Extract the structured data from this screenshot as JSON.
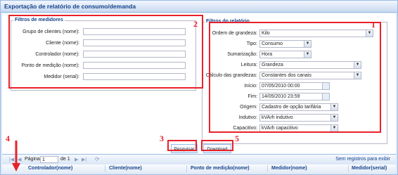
{
  "window": {
    "title": "Exportação de relatório de consumo/demanda"
  },
  "filters_meters": {
    "legend": "Filtros de medidores",
    "fields": [
      {
        "label": "Grupo de clientes (nome):",
        "value": ""
      },
      {
        "label": "Cliente (nome):",
        "value": ""
      },
      {
        "label": "Controlador (nome):",
        "value": ""
      },
      {
        "label": "Ponto de medição (nome):",
        "value": ""
      },
      {
        "label": "Medidor (serial):",
        "value": ""
      }
    ]
  },
  "filters_report": {
    "legend": "Filtros do relatório",
    "ordem": {
      "label": "Ordem de grandeza:",
      "value": "Kilo"
    },
    "tipo": {
      "label": "Tipo:",
      "value": "Consumo"
    },
    "sumarizacao": {
      "label": "Sumarização:",
      "value": "Hora"
    },
    "leitura": {
      "label": "Leitura:",
      "value": "Grandeza"
    },
    "calculo": {
      "label": "Cálculo das grandezas:",
      "value": "Constantes dos canais"
    },
    "inicio": {
      "label": "Início:",
      "value": "07/05/2010 00:00"
    },
    "fim": {
      "label": "Fim:",
      "value": "14/05/2010 23:59"
    },
    "origem": {
      "label": "Origem:",
      "value": "Cadastro de opção tarifária"
    },
    "indutivo": {
      "label": "Indutivo:",
      "value": "kVArh indutivo"
    },
    "capacitivo": {
      "label": "Capacitivo:",
      "value": "kVArh capacitivo"
    }
  },
  "buttons": {
    "pesquisar": "Pesquisar",
    "download": "Download"
  },
  "pager": {
    "page_label": "Página",
    "page_value": "1",
    "of_label": "de 1",
    "empty_msg": "Sem registros para exibir"
  },
  "grid": {
    "columns": [
      "Controlador(nome)",
      "Cliente(nome)",
      "Ponto de medição(nome)",
      "Medidor(nome)",
      "Medidor(serial)"
    ]
  },
  "annotations": [
    "1",
    "2",
    "3",
    "4",
    "5"
  ],
  "colors": {
    "annotation": "#e8212a",
    "header_text": "#15428b",
    "border": "#99bbe8"
  }
}
